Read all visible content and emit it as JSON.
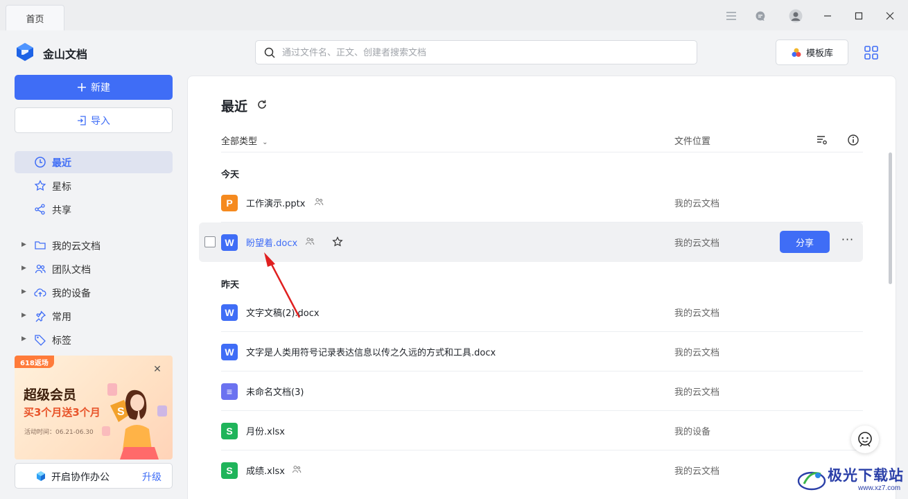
{
  "titlebar": {
    "tab_label": "首页"
  },
  "sidebar": {
    "app_name": "金山文档",
    "new_label": "新建",
    "import_label": "导入",
    "nav": [
      {
        "label": "最近",
        "icon": "clock-icon",
        "active": true
      },
      {
        "label": "星标",
        "icon": "star-icon"
      },
      {
        "label": "共享",
        "icon": "share-icon"
      }
    ],
    "tree": [
      {
        "label": "我的云文档",
        "icon": "folder-icon"
      },
      {
        "label": "团队文档",
        "icon": "team-icon"
      },
      {
        "label": "我的设备",
        "icon": "cloud-upload-icon"
      },
      {
        "label": "常用",
        "icon": "pin-icon"
      },
      {
        "label": "标签",
        "icon": "tag-icon"
      }
    ],
    "promo": {
      "tag": "618返场",
      "title": "超级会员",
      "subtitle": "买3个月送3个月",
      "date": "活动时间：06.21-06.30"
    },
    "collab": {
      "label": "开启协作办公",
      "upgrade": "升级"
    }
  },
  "search": {
    "placeholder": "通过文件名、正文、创建者搜索文档"
  },
  "toolbar": {
    "template_label": "模板库"
  },
  "main": {
    "title": "最近",
    "filter_label": "全部类型",
    "location_header": "文件位置",
    "groups": {
      "today": "今天",
      "yesterday": "昨天"
    },
    "files": [
      {
        "name": "工作演示.pptx",
        "type": "P",
        "color": "#f58a1f",
        "location": "我的云文档",
        "shared": true
      },
      {
        "name": "盼望着.docx",
        "type": "W",
        "color": "#3f6df6",
        "location": "我的云文档",
        "shared": true,
        "hover": true
      },
      {
        "name": "文字文稿(2).docx",
        "type": "W",
        "color": "#3f6df6",
        "location": "我的云文档",
        "shared": false
      },
      {
        "name": "文字是人类用符号记录表达信息以传之久远的方式和工具.docx",
        "type": "W",
        "color": "#3f6df6",
        "location": "我的云文档",
        "shared": false
      },
      {
        "name": "未命名文档(3)",
        "type": "≡",
        "color": "#6b72f0",
        "location": "我的云文档",
        "shared": false
      },
      {
        "name": "月份.xlsx",
        "type": "S",
        "color": "#1fb45a",
        "location": "我的设备",
        "shared": false
      },
      {
        "name": "成绩.xlsx",
        "type": "S",
        "color": "#1fb45a",
        "location": "我的云文档",
        "shared": true
      }
    ],
    "share_label": "分享"
  },
  "watermark": {
    "title": "极光下载站",
    "url": "www.xz7.com"
  }
}
